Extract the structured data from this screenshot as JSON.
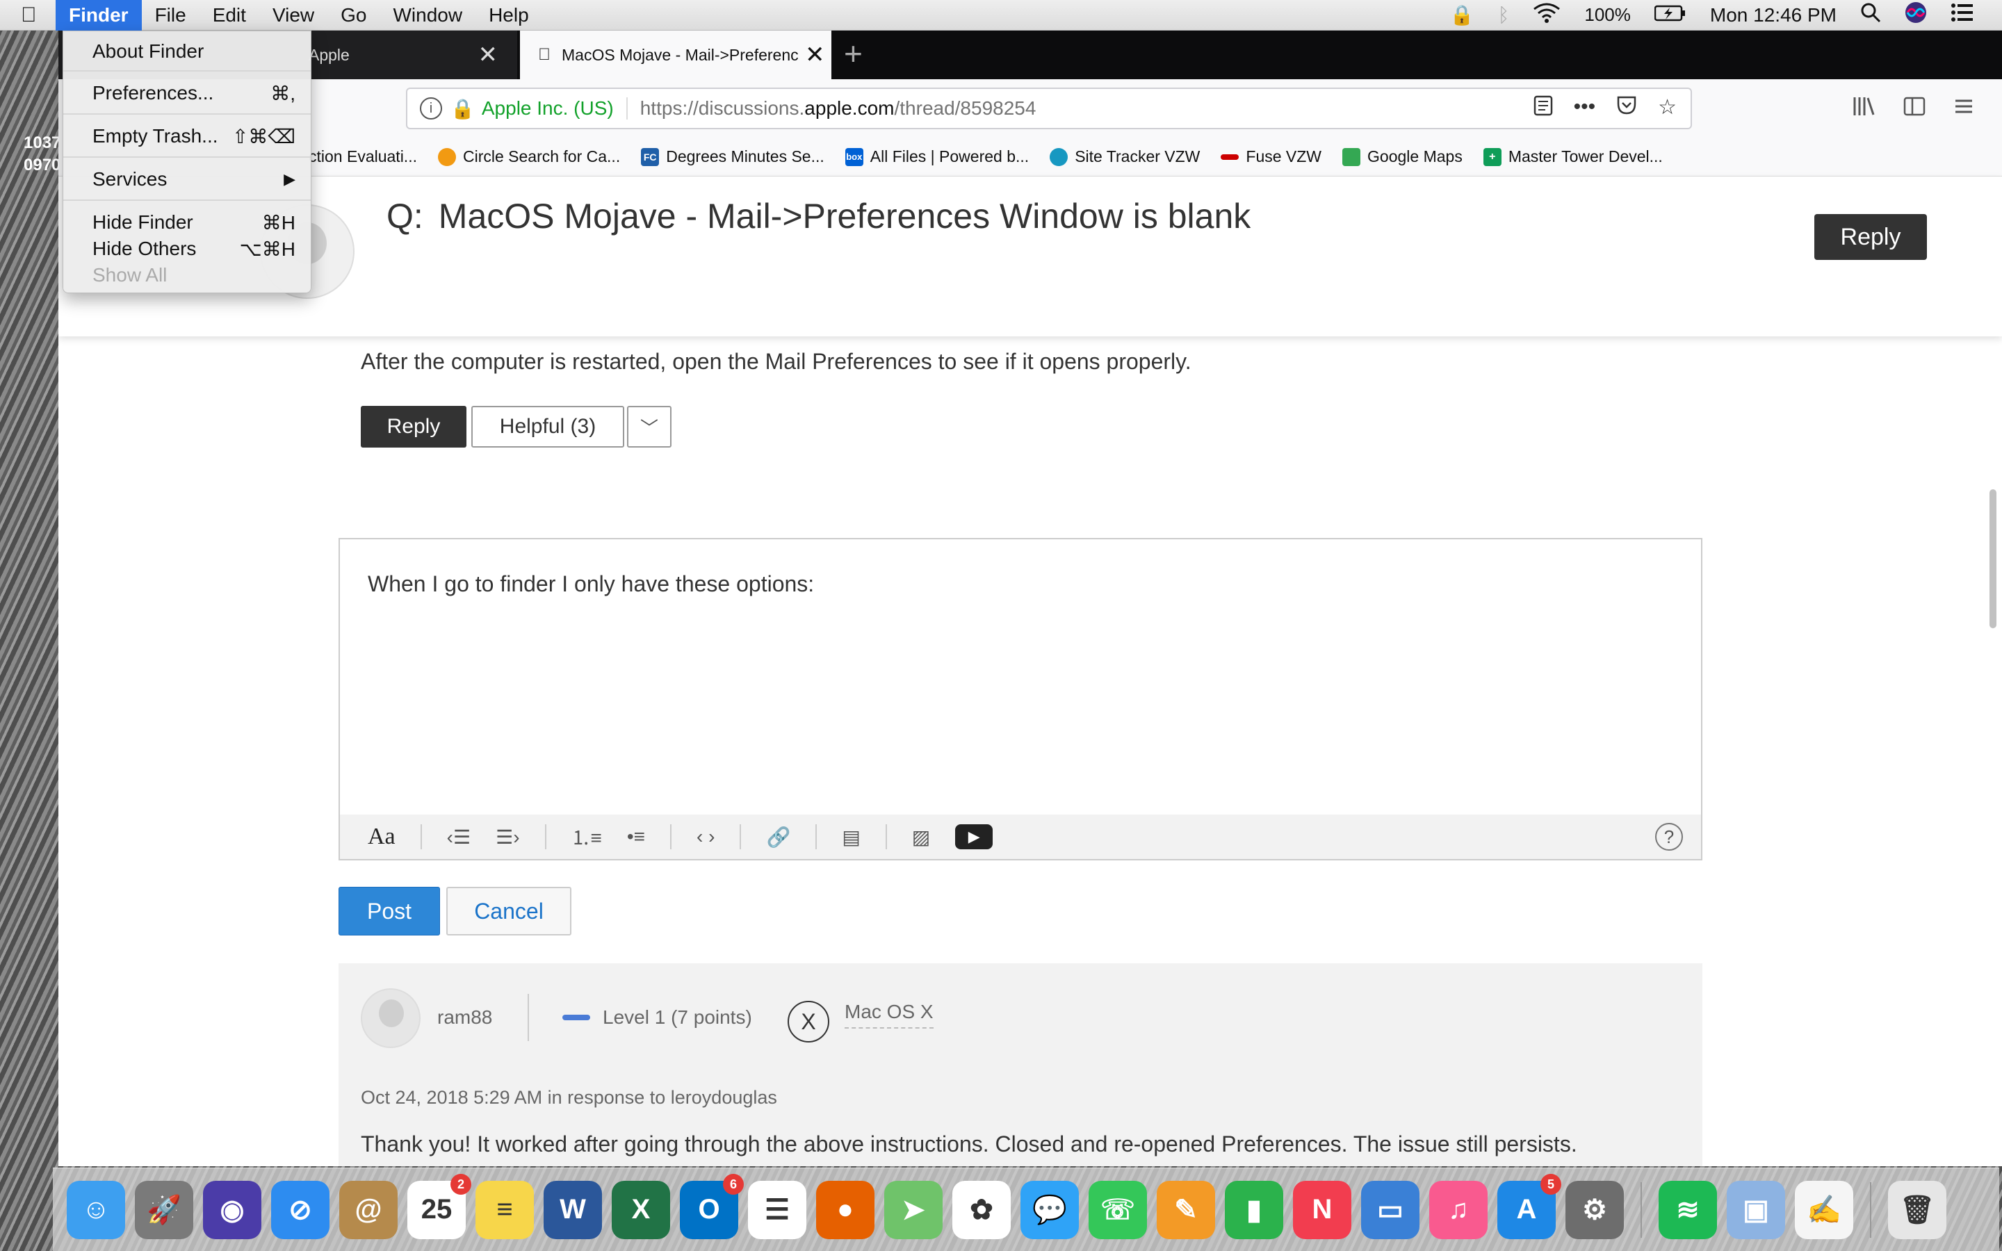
{
  "desktop": {
    "text_line1": "1037",
    "text_line2": "0970"
  },
  "menubar": {
    "apple_icon": "apple-logo-icon",
    "items": [
      "Finder",
      "File",
      "Edit",
      "View",
      "Go",
      "Window",
      "Help"
    ],
    "battery": "100%",
    "clock": "Mon 12:46 PM"
  },
  "finder_menu": {
    "about": "About Finder",
    "preferences": "Preferences...",
    "preferences_sc": "⌘,",
    "empty_trash": "Empty Trash...",
    "empty_trash_sc": "⇧⌘⌫",
    "services": "Services",
    "services_arrow": "▶",
    "hide_finder": "Hide Finder",
    "hide_finder_sc": "⌘H",
    "hide_others": "Hide Others",
    "hide_others_sc": "⌥⌘H",
    "show_all": "Show All"
  },
  "tabs": [
    {
      "title": "Apple",
      "close": "✕"
    },
    {
      "title": "MacOS Mojave - Mail->Preferences Window is blank",
      "close": "✕"
    }
  ],
  "newtab": "+",
  "urlbar": {
    "info": "i",
    "org": "Apple Inc. (US)",
    "url_prefix": "https://discussions.",
    "url_domain": "apple.com",
    "url_suffix": "/thread/8598254",
    "more": "•••"
  },
  "bookmarks": [
    {
      "label": "ction Evaluati...",
      "color": "#888888",
      "glyph": ""
    },
    {
      "label": "Circle Search for Ca...",
      "color": "#f29a12",
      "glyph": ""
    },
    {
      "label": "Degrees Minutes Se...",
      "color": "#1f5fa8",
      "glyph": "FC"
    },
    {
      "label": "All Files | Powered b...",
      "color": "#0061d5",
      "glyph": "box"
    },
    {
      "label": "Site Tracker VZW",
      "color": "#1798c1",
      "glyph": ""
    },
    {
      "label": "Fuse VZW",
      "color": "#cc0000",
      "glyph": ""
    },
    {
      "label": "Google Maps",
      "color": "#34a853",
      "glyph": ""
    },
    {
      "label": "Master Tower Devel...",
      "color": "#0f9d58",
      "glyph": "+"
    }
  ],
  "question": {
    "prefix": "Q:",
    "title": "MacOS Mojave - Mail->Preferences Window is blank",
    "reply": "Reply"
  },
  "answer": {
    "text": "After the computer is restarted, open the Mail Preferences to see if it opens properly.",
    "reply": "Reply",
    "helpful": "Helpful (3)",
    "more": "﹀"
  },
  "editor": {
    "text": "When I go to finder I only have these options:",
    "aa": "Aa",
    "outdent": "‹☰",
    "indent": "☰›",
    "numbered": "⒈≡",
    "bulleted": "•≡",
    "code": "‹ ›",
    "link": "🔗",
    "doc": "▤",
    "image": "▨",
    "video": "▶",
    "help": "?"
  },
  "post": "Post",
  "cancel": "Cancel",
  "reply_card": {
    "user": "ram88",
    "level": "Level 1  (7 points)",
    "os_glyph": "X",
    "os": "Mac OS X",
    "date": "Oct 24, 2018 5:29 AM in response to leroydouglas",
    "body": "Thank you!  It worked after going through the above instructions.   Closed and re-opened Preferences.   The issue still persists.   Repeated the above instructions.  Worked the first time.  Closed and re-opened Preferences.   The same issue,"
  },
  "dock": [
    {
      "name": "finder",
      "color": "#3d9ff0",
      "glyph": "☺",
      "badge": ""
    },
    {
      "name": "launchpad",
      "color": "#7a7a7a",
      "glyph": "🚀",
      "badge": ""
    },
    {
      "name": "siri",
      "color": "#4b3ca8",
      "glyph": "◉",
      "badge": ""
    },
    {
      "name": "safari",
      "color": "#2d8cf0",
      "glyph": "⊘",
      "badge": ""
    },
    {
      "name": "contacts",
      "color": "#b58a4c",
      "glyph": "@",
      "badge": ""
    },
    {
      "name": "calendar",
      "color": "#ffffff",
      "glyph": "25",
      "badge": "2"
    },
    {
      "name": "notes",
      "color": "#f7d64a",
      "glyph": "≡",
      "badge": ""
    },
    {
      "name": "word",
      "color": "#2b579a",
      "glyph": "W",
      "badge": ""
    },
    {
      "name": "excel",
      "color": "#217346",
      "glyph": "X",
      "badge": ""
    },
    {
      "name": "outlook",
      "color": "#0072c6",
      "glyph": "O",
      "badge": "6"
    },
    {
      "name": "reminders",
      "color": "#ffffff",
      "glyph": "☰",
      "badge": ""
    },
    {
      "name": "firefox",
      "color": "#e66000",
      "glyph": "●",
      "badge": ""
    },
    {
      "name": "maps",
      "color": "#6fc36a",
      "glyph": "➤",
      "badge": ""
    },
    {
      "name": "photos",
      "color": "#ffffff",
      "glyph": "✿",
      "badge": ""
    },
    {
      "name": "messages",
      "color": "#2fa3f7",
      "glyph": "💬",
      "badge": ""
    },
    {
      "name": "facetime",
      "color": "#34c759",
      "glyph": "☏",
      "badge": ""
    },
    {
      "name": "pages",
      "color": "#f39a26",
      "glyph": "✎",
      "badge": ""
    },
    {
      "name": "numbers",
      "color": "#2bb24c",
      "glyph": "▮",
      "badge": ""
    },
    {
      "name": "news",
      "color": "#f23d4f",
      "glyph": "N",
      "badge": ""
    },
    {
      "name": "keynote",
      "color": "#3a80d6",
      "glyph": "▭",
      "badge": ""
    },
    {
      "name": "itunes",
      "color": "#f95a8f",
      "glyph": "♫",
      "badge": ""
    },
    {
      "name": "app-store",
      "color": "#1e88e5",
      "glyph": "A",
      "badge": "5"
    },
    {
      "name": "system-preferences",
      "color": "#6d6d6d",
      "glyph": "⚙",
      "badge": ""
    },
    {
      "name": "spotify",
      "color": "#1db954",
      "glyph": "≋",
      "badge": ""
    },
    {
      "name": "preview",
      "color": "#8db3e2",
      "glyph": "▣",
      "badge": ""
    },
    {
      "name": "textedit",
      "color": "#f5f5f5",
      "glyph": "✍",
      "badge": ""
    },
    {
      "name": "trash",
      "color": "#e6e6e6",
      "glyph": "🗑",
      "badge": ""
    }
  ]
}
